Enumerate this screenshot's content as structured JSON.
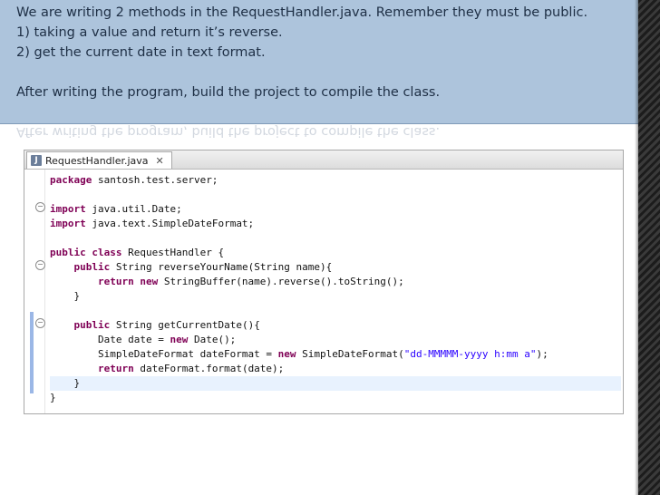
{
  "banner": {
    "line1": "We are writing 2 methods in the RequestHandler.java. Remember they must be public.",
    "line2": "1) taking a value and return it’s reverse.",
    "line3": "2) get the current date in text format.",
    "line4": "After writing the program, build the project to compile the class."
  },
  "editor": {
    "tab_label": "RequestHandler.java",
    "tab_close": "✕",
    "file_icon_letter": "J",
    "code": [
      {
        "parts": [
          [
            "kw",
            "package"
          ],
          [
            "",
            " santosh.test.server;"
          ]
        ]
      },
      {
        "parts": [
          [
            "",
            ""
          ]
        ]
      },
      {
        "parts": [
          [
            "kw",
            "import"
          ],
          [
            "",
            " java.util.Date;"
          ]
        ]
      },
      {
        "parts": [
          [
            "kw",
            "import"
          ],
          [
            "",
            " java.text.SimpleDateFormat;"
          ]
        ]
      },
      {
        "parts": [
          [
            "",
            ""
          ]
        ]
      },
      {
        "parts": [
          [
            "kw",
            "public class"
          ],
          [
            "",
            " RequestHandler {"
          ]
        ]
      },
      {
        "parts": [
          [
            "",
            "    "
          ],
          [
            "kw",
            "public"
          ],
          [
            "",
            " String reverseYourName(String name){"
          ]
        ]
      },
      {
        "parts": [
          [
            "",
            "        "
          ],
          [
            "kw",
            "return new"
          ],
          [
            "",
            " StringBuffer(name).reverse().toString();"
          ]
        ]
      },
      {
        "parts": [
          [
            "",
            "    }"
          ]
        ]
      },
      {
        "parts": [
          [
            "",
            ""
          ]
        ]
      },
      {
        "parts": [
          [
            "",
            "    "
          ],
          [
            "kw",
            "public"
          ],
          [
            "",
            " String getCurrentDate(){"
          ]
        ]
      },
      {
        "parts": [
          [
            "",
            "        Date date = "
          ],
          [
            "kw",
            "new"
          ],
          [
            "",
            " Date();"
          ]
        ]
      },
      {
        "parts": [
          [
            "",
            "        SimpleDateFormat dateFormat = "
          ],
          [
            "kw",
            "new"
          ],
          [
            "",
            " SimpleDateFormat("
          ],
          [
            "str",
            "\"dd-MMMMM-yyyy h:mm a\""
          ],
          [
            "",
            ");"
          ]
        ]
      },
      {
        "parts": [
          [
            "",
            "        "
          ],
          [
            "kw",
            "return"
          ],
          [
            "",
            " dateFormat.format(date);"
          ]
        ]
      },
      {
        "parts": [
          [
            "",
            "    }"
          ]
        ]
      },
      {
        "parts": [
          [
            "",
            "}"
          ]
        ]
      }
    ]
  }
}
